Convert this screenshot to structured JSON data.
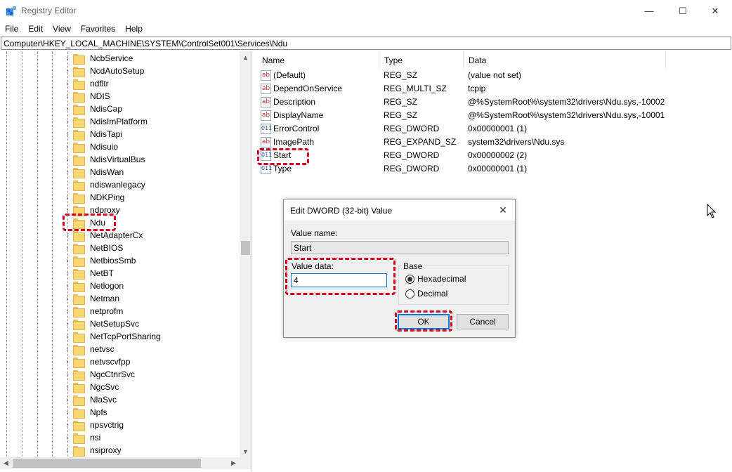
{
  "window": {
    "title": "Registry Editor",
    "icon": "registry-editor-icon",
    "controls": {
      "minimize": "—",
      "maximize": "☐",
      "close": "✕"
    }
  },
  "menu": [
    "File",
    "Edit",
    "View",
    "Favorites",
    "Help"
  ],
  "address": "Computer\\HKEY_LOCAL_MACHINE\\SYSTEM\\ControlSet001\\Services\\Ndu",
  "tree": {
    "nodes": [
      {
        "label": "NcbService",
        "expandable": true
      },
      {
        "label": "NcdAutoSetup",
        "expandable": true
      },
      {
        "label": "ndfltr",
        "expandable": true
      },
      {
        "label": "NDIS",
        "expandable": true
      },
      {
        "label": "NdisCap",
        "expandable": true
      },
      {
        "label": "NdisImPlatform",
        "expandable": true
      },
      {
        "label": "NdisTapi",
        "expandable": true
      },
      {
        "label": "Ndisuio",
        "expandable": true
      },
      {
        "label": "NdisVirtualBus",
        "expandable": true
      },
      {
        "label": "NdisWan",
        "expandable": true
      },
      {
        "label": "ndiswanlegacy",
        "expandable": false
      },
      {
        "label": "NDKPing",
        "expandable": true
      },
      {
        "label": "ndproxy",
        "expandable": true
      },
      {
        "label": "Ndu",
        "expandable": false,
        "selected": true
      },
      {
        "label": "NetAdapterCx",
        "expandable": true
      },
      {
        "label": "NetBIOS",
        "expandable": true
      },
      {
        "label": "NetbiosSmb",
        "expandable": true
      },
      {
        "label": "NetBT",
        "expandable": true
      },
      {
        "label": "Netlogon",
        "expandable": true
      },
      {
        "label": "Netman",
        "expandable": true
      },
      {
        "label": "netprofm",
        "expandable": true
      },
      {
        "label": "NetSetupSvc",
        "expandable": true
      },
      {
        "label": "NetTcpPortSharing",
        "expandable": true
      },
      {
        "label": "netvsc",
        "expandable": true
      },
      {
        "label": "netvscvfpp",
        "expandable": true
      },
      {
        "label": "NgcCtnrSvc",
        "expandable": true
      },
      {
        "label": "NgcSvc",
        "expandable": true
      },
      {
        "label": "NlaSvc",
        "expandable": true
      },
      {
        "label": "Npfs",
        "expandable": true
      },
      {
        "label": "npsvctrig",
        "expandable": true
      },
      {
        "label": "nsi",
        "expandable": true
      },
      {
        "label": "nsiproxy",
        "expandable": true
      }
    ]
  },
  "values": {
    "columns": [
      "Name",
      "Type",
      "Data"
    ],
    "rows": [
      {
        "icon": "string-value-icon",
        "name": "(Default)",
        "type": "REG_SZ",
        "data": "(value not set)"
      },
      {
        "icon": "string-value-icon",
        "name": "DependOnService",
        "type": "REG_MULTI_SZ",
        "data": "tcpip"
      },
      {
        "icon": "string-value-icon",
        "name": "Description",
        "type": "REG_SZ",
        "data": "@%SystemRoot%\\system32\\drivers\\Ndu.sys,-10002"
      },
      {
        "icon": "string-value-icon",
        "name": "DisplayName",
        "type": "REG_SZ",
        "data": "@%SystemRoot%\\system32\\drivers\\Ndu.sys,-10001"
      },
      {
        "icon": "binary-value-icon",
        "name": "ErrorControl",
        "type": "REG_DWORD",
        "data": "0x00000001 (1)"
      },
      {
        "icon": "string-value-icon",
        "name": "ImagePath",
        "type": "REG_EXPAND_SZ",
        "data": "system32\\drivers\\Ndu.sys"
      },
      {
        "icon": "binary-value-icon",
        "name": "Start",
        "type": "REG_DWORD",
        "data": "0x00000002 (2)"
      },
      {
        "icon": "binary-value-icon",
        "name": "Type",
        "type": "REG_DWORD",
        "data": "0x00000001 (1)"
      }
    ]
  },
  "dialog": {
    "title": "Edit DWORD (32-bit) Value",
    "value_name_label": "Value name:",
    "value_name": "Start",
    "value_data_label": "Value data:",
    "value_data": "4",
    "base_label": "Base",
    "radio_hex": "Hexadecimal",
    "radio_dec": "Decimal",
    "selected_base": "Hexadecimal",
    "ok": "OK",
    "cancel": "Cancel"
  },
  "colors": {
    "highlight": "#d6001c",
    "focus": "#0078d7",
    "folder": "#f8d775"
  }
}
